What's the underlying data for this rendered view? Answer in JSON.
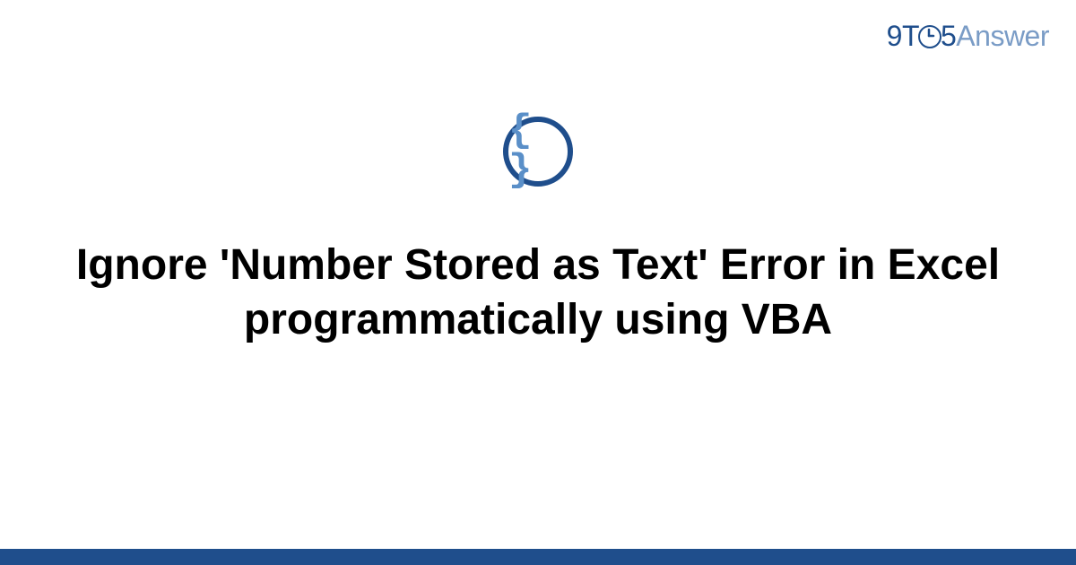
{
  "logo": {
    "part1": "9T",
    "part2": "5",
    "part3": "Answer"
  },
  "icon": {
    "braces": "{ }"
  },
  "title": "Ignore 'Number Stored as Text' Error in Excel programmatically using VBA",
  "colors": {
    "primary": "#1f4e8c",
    "secondary": "#7a9cc6",
    "brace": "#5a8fc8"
  }
}
